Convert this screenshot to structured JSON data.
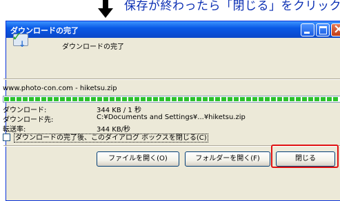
{
  "instruction": {
    "text": "保存が終わったら「閉じる」をクリック"
  },
  "window": {
    "title": "ダウンロードの完了",
    "header_label": "ダウンロードの完了",
    "url": "www.photo-con.com - hiketsu.zip",
    "progress": 1.0,
    "rows": [
      {
        "label": "ダウンロード:",
        "value": "344 KB / 1 秒"
      },
      {
        "label": "ダウンロード先:",
        "value": "C:¥Documents and Settings¥...¥hiketsu.zip"
      },
      {
        "label": "転送率:",
        "value": "344 KB/秒"
      }
    ],
    "checkbox_label": "ダウンロードの完了後、このダイアログ ボックスを閉じる(C)",
    "checkbox_checked": false,
    "buttons": {
      "open_file": "ファイルを開く(O)",
      "open_folder": "フォルダーを開く(F)",
      "close": "閉じる"
    }
  },
  "colors": {
    "highlight": "#e01010",
    "title_bar": "#0a5ae6",
    "instruction_text": "#0b2fb3",
    "progress": "#2bc22b"
  }
}
